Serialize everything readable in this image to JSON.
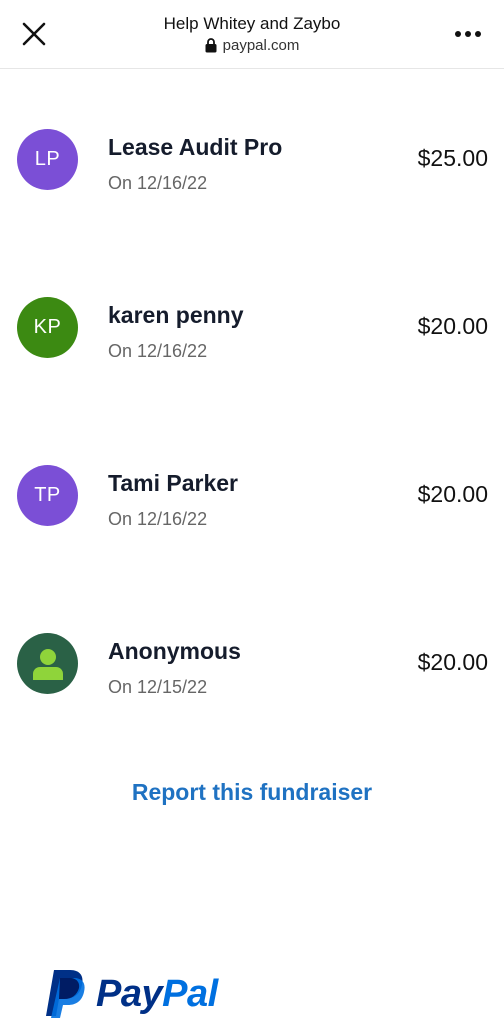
{
  "header": {
    "title": "Help Whitey and Zaybo",
    "url": "paypal.com",
    "close_icon": "close-icon",
    "lock_icon": "lock-icon",
    "more_icon": "more-horizontal-icon"
  },
  "donors": [
    {
      "initials": "LP",
      "name": "Lease Audit Pro",
      "date": "On 12/16/22",
      "amount": "$25.00",
      "color": "#7b4fd6"
    },
    {
      "initials": "KP",
      "name": "karen penny",
      "date": "On 12/16/22",
      "amount": "$20.00",
      "color": "#3c8a12"
    },
    {
      "initials": "TP",
      "name": "Tami Parker",
      "date": "On 12/16/22",
      "amount": "$20.00",
      "color": "#7b4fd6"
    },
    {
      "initials": "",
      "name": "Anonymous",
      "date": "On 12/15/22",
      "amount": "$20.00",
      "color": "#2a6146",
      "icon": "person-icon",
      "icon_color": "#8fd43a"
    }
  ],
  "report_link": "Report this fundraiser",
  "brand": {
    "name_part1": "Pay",
    "name_part2": "Pal",
    "color_dark": "#003087",
    "color_light": "#0070e0"
  }
}
